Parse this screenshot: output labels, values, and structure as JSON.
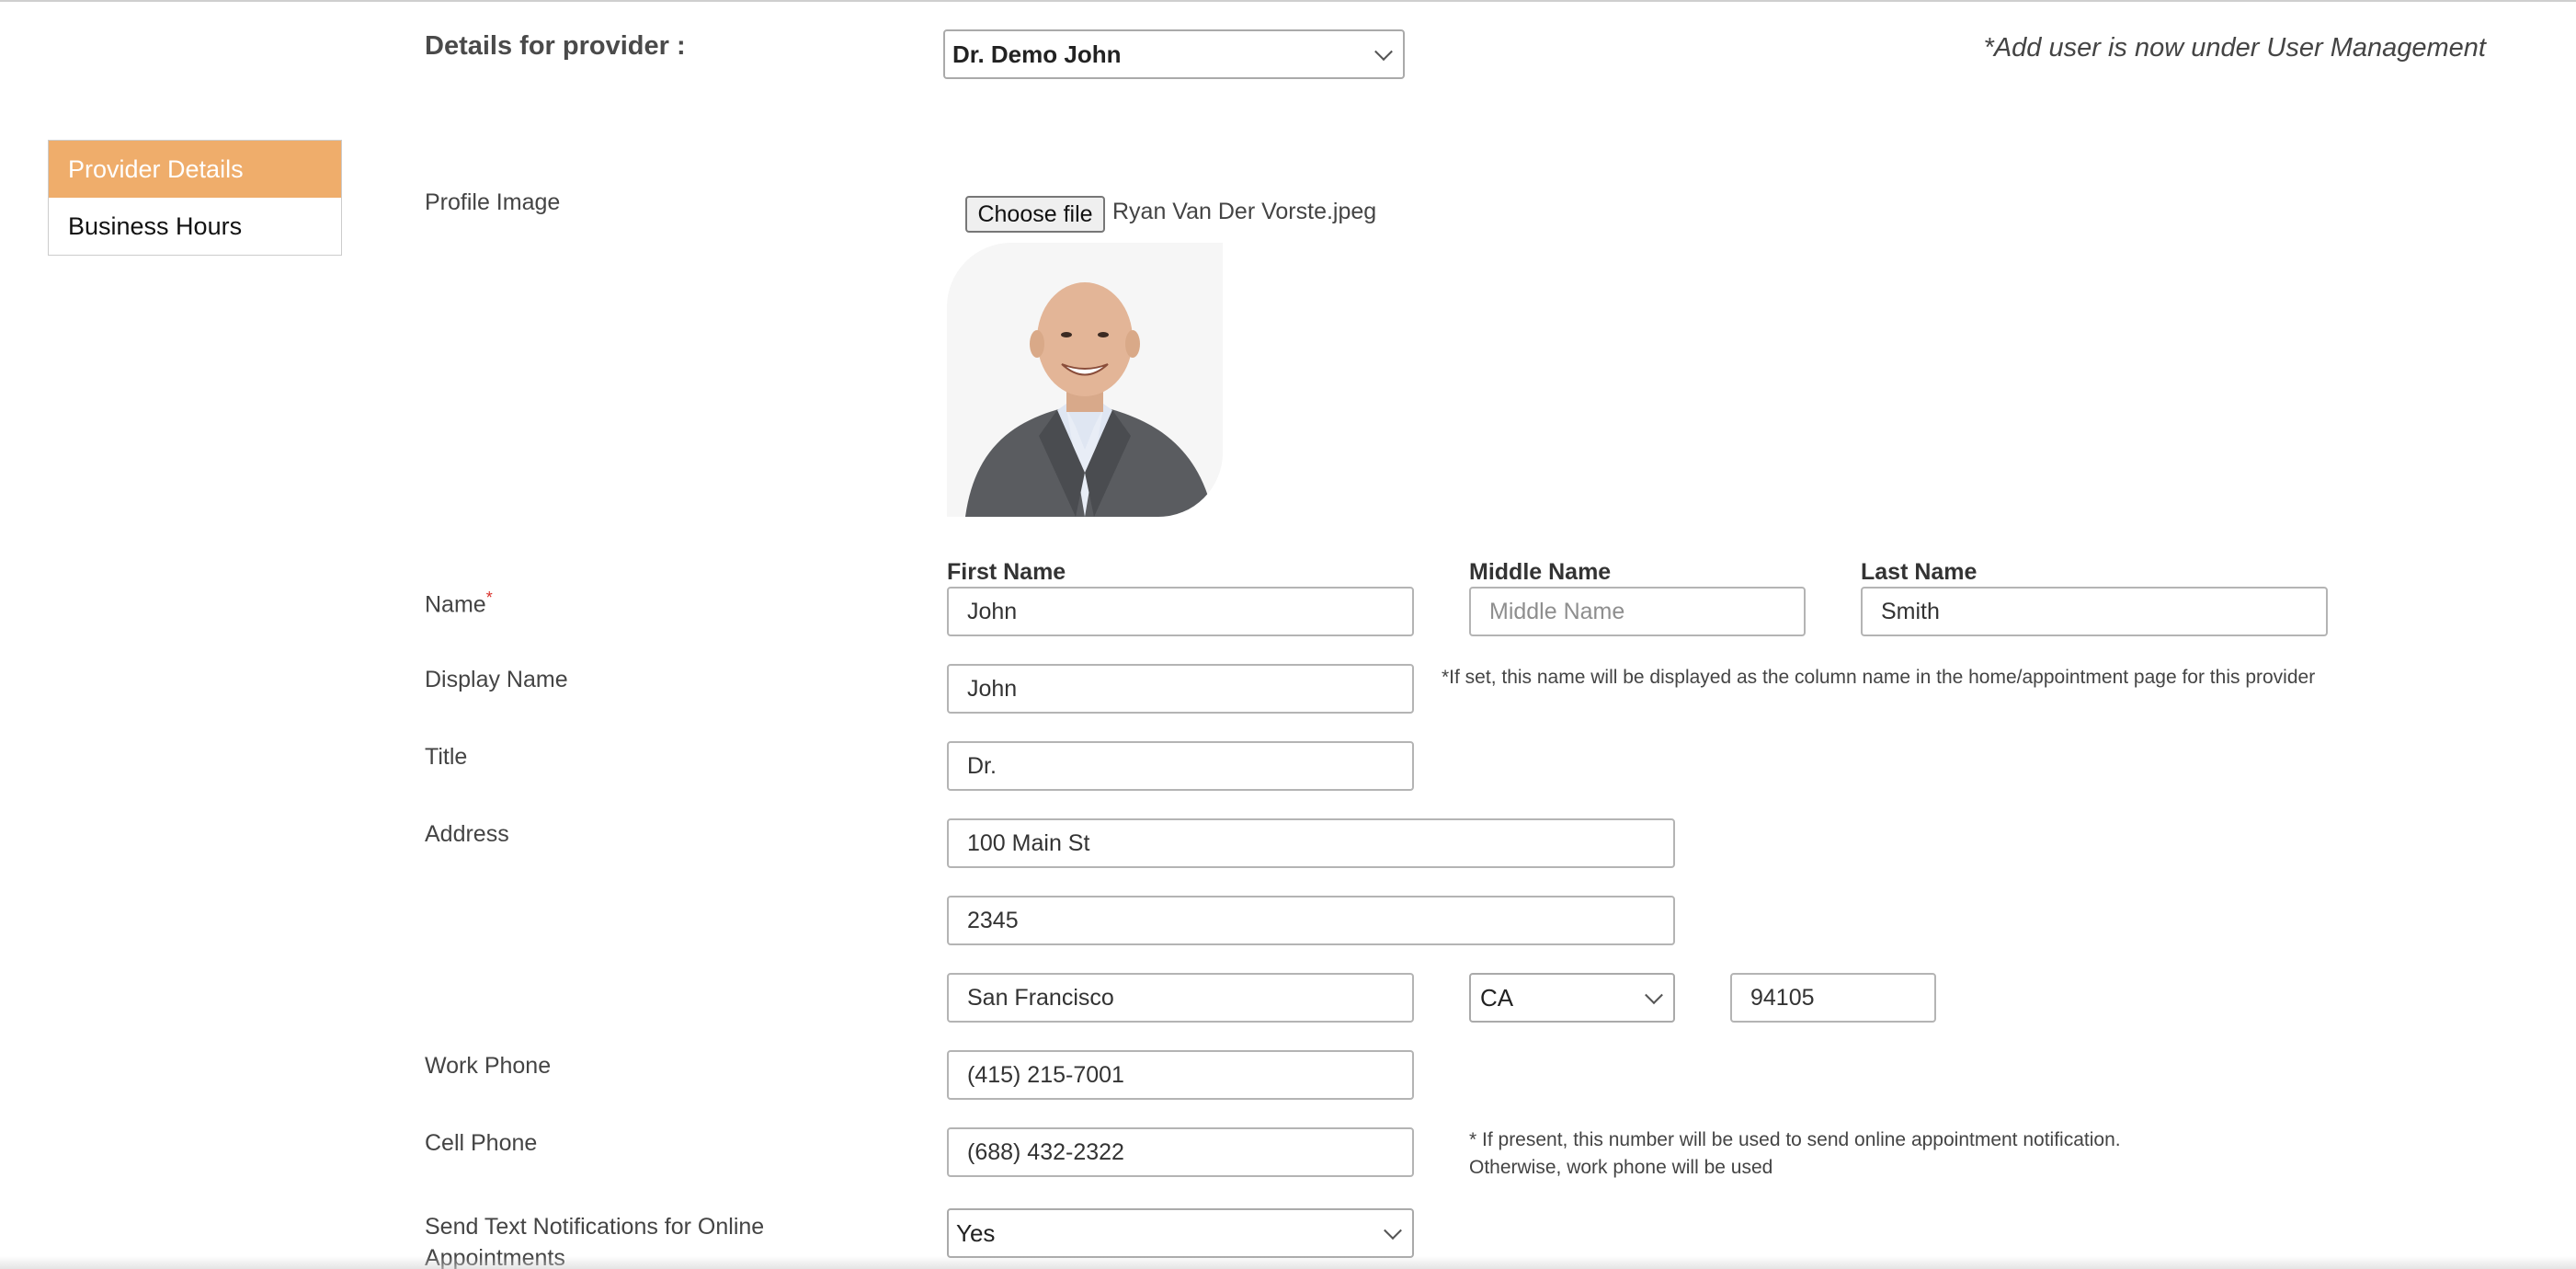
{
  "header": {
    "title": "Details for provider :",
    "provider_selected": "Dr. Demo John",
    "add_user_note": "*Add user is now under User Management"
  },
  "sidebar": {
    "items": [
      {
        "label": "Provider Details",
        "active": true
      },
      {
        "label": "Business Hours",
        "active": false
      }
    ]
  },
  "form": {
    "profile_image": {
      "label": "Profile Image",
      "choose_button": "Choose file",
      "file_name": "Ryan Van Der Vorste.jpeg"
    },
    "name": {
      "label": "Name",
      "required_mark": "*",
      "first_name_label": "First Name",
      "first_name_value": "John",
      "middle_name_label": "Middle Name",
      "middle_name_placeholder": "Middle Name",
      "last_name_label": "Last Name",
      "last_name_value": "Smith"
    },
    "display_name": {
      "label": "Display Name",
      "value": "John",
      "hint": "*If set, this name will be displayed as the column name in the home/appointment page for this provider"
    },
    "title": {
      "label": "Title",
      "value": "Dr."
    },
    "address": {
      "label": "Address",
      "line1": "100 Main St",
      "line2": "2345",
      "city": "San Francisco",
      "state": "CA",
      "zip": "94105"
    },
    "work_phone": {
      "label": "Work Phone",
      "value": "(415) 215-7001"
    },
    "cell_phone": {
      "label": "Cell Phone",
      "value": "(688) 432-2322",
      "hint_line1": "* If present, this number will be used to send online appointment notification.",
      "hint_line2": "Otherwise, work phone will be used"
    },
    "text_notifications": {
      "label_line1": "Send Text Notifications for Online",
      "label_line2": "Appointments",
      "value": "Yes"
    }
  },
  "colors": {
    "active_tab": "#efad6b",
    "required": "#d9302a"
  }
}
